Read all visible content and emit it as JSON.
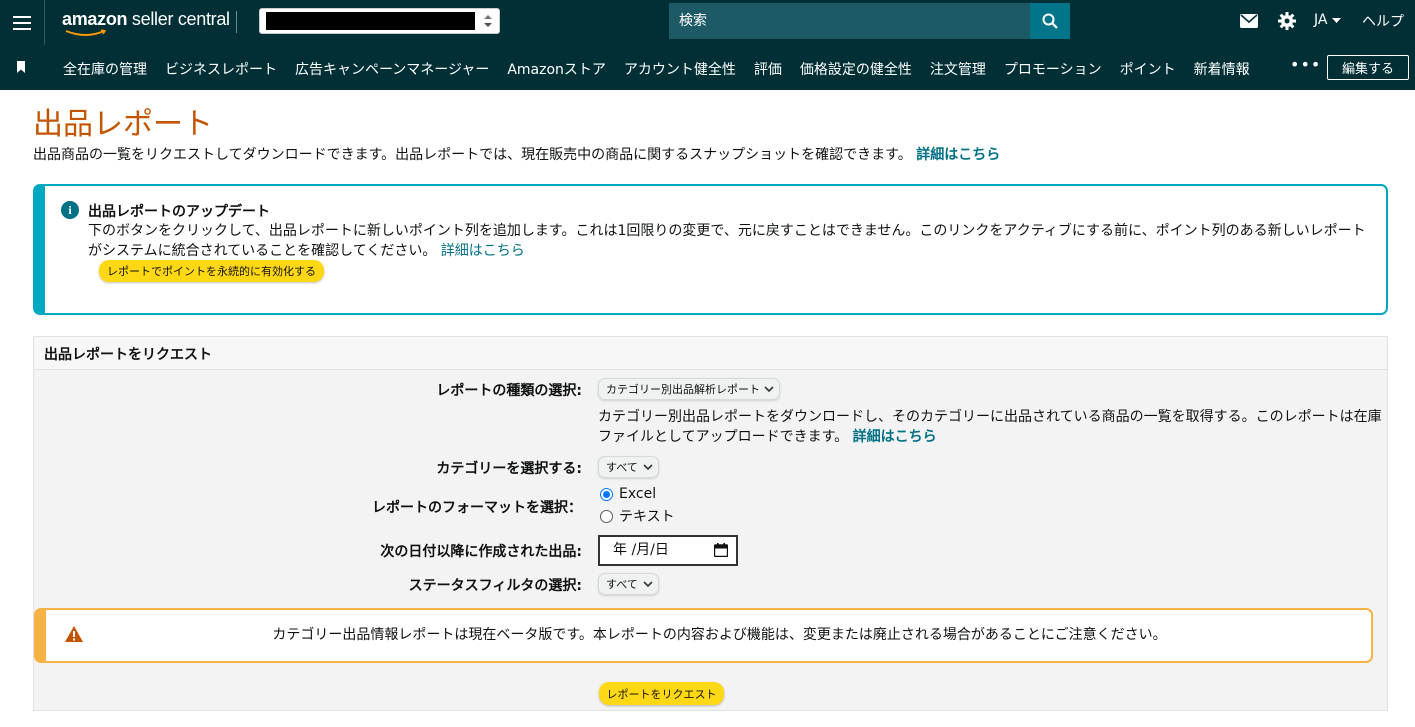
{
  "header": {
    "logo_amazon": "amazon",
    "logo_rest": " seller central",
    "search_placeholder": "検索",
    "language": "JA",
    "help": "ヘルプ",
    "icons": [
      "menu-icon",
      "mail-icon",
      "gear-icon",
      "search-icon"
    ]
  },
  "nav": {
    "items": [
      "全在庫の管理",
      "ビジネスレポート",
      "広告キャンペーンマネージャー",
      "Amazonストア",
      "アカウント健全性",
      "評価",
      "価格設定の健全性",
      "注文管理",
      "プロモーション",
      "ポイント",
      "新着情報"
    ],
    "more": "•••",
    "edit": "編集する"
  },
  "page": {
    "title": "出品レポート",
    "description": "出品商品の一覧をリクエストしてダウンロードできます。出品レポートでは、現在販売中の商品に関するスナップショットを確認できます。",
    "learn_more": "詳細はこちら"
  },
  "info": {
    "title": "出品レポートのアップデート",
    "body": "下のボタンをクリックして、出品レポートに新しいポイント列を追加します。これは1回限りの変更で、元に戻すことはできません。このリンクをアクティブにする前に、ポイント列のある新しいレポートがシステムに統合されていることを確認してください。",
    "link": "詳細はこちら",
    "button": "レポートでポイントを永続的に有効化する"
  },
  "request": {
    "heading": "出品レポートをリクエスト",
    "report_type_label": "レポートの種類の選択:",
    "report_type_value": "カテゴリー別出品解析レポート",
    "report_type_help": "カテゴリー別出品レポートをダウンロードし、そのカテゴリーに出品されている商品の一覧を取得する。このレポートは在庫ファイルとしてアップロードできます。",
    "report_type_link": "詳細はこちら",
    "category_label": "カテゴリーを選択する:",
    "category_value": "すべて",
    "format_label": "レポートのフォーマットを選択：",
    "format_options": [
      "Excel",
      "テキスト"
    ],
    "format_selected": "Excel",
    "date_label": "次の日付以降に作成された出品:",
    "date_placeholder": "年 /月/日",
    "status_label": "ステータスフィルタの選択:",
    "status_value": "すべて",
    "warning": "カテゴリー出品情報レポートは現在ベータ版です。本レポートの内容および機能は、変更または廃止される場合があることにご注意ください。",
    "submit": "レポートをリクエスト"
  },
  "colors": {
    "header_bg": "#002f36",
    "title": "#c45500",
    "link": "#007185",
    "info_border": "#00a8c1",
    "warn_border": "#f7b144",
    "button_yellow": "#ffd814"
  }
}
